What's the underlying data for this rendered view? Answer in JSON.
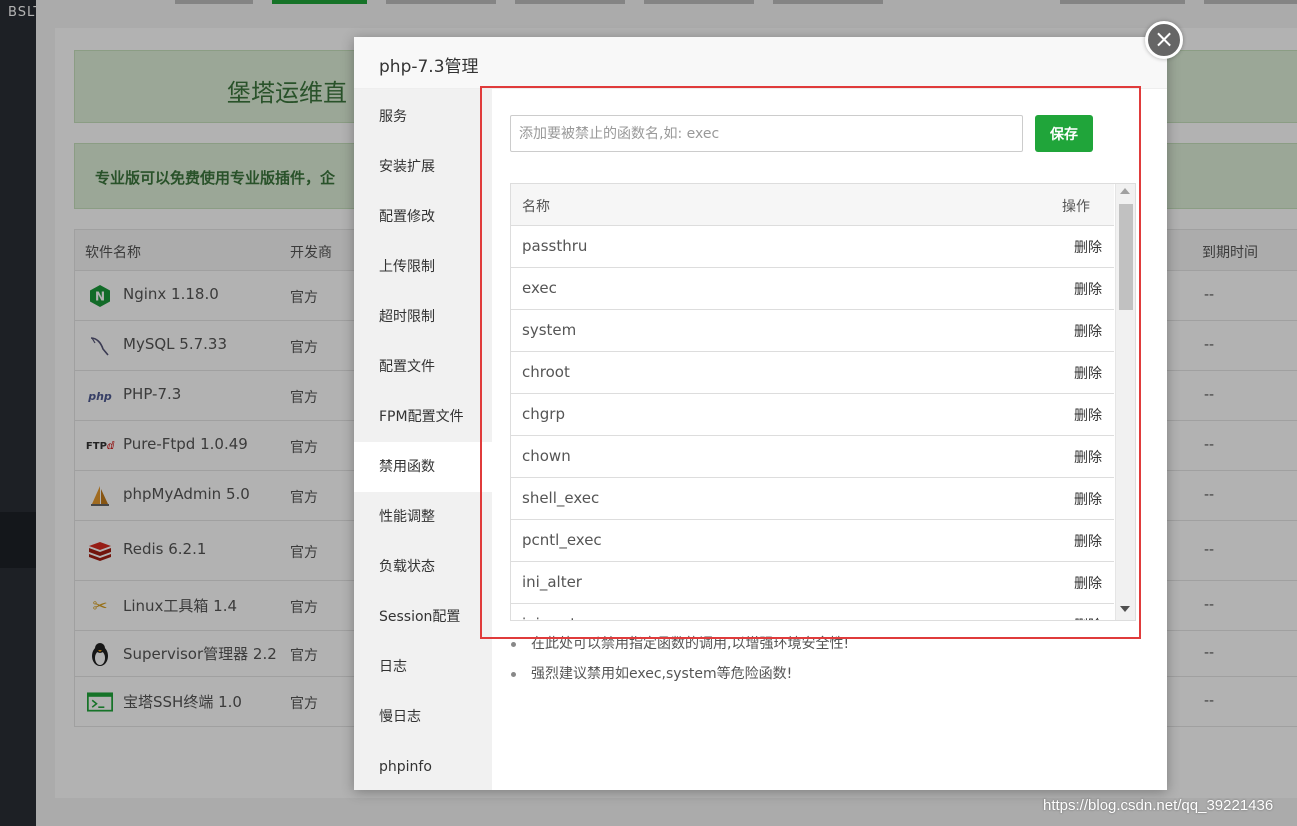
{
  "brand": "BSLT",
  "background": {
    "banner_title": "堡塔运维直",
    "banner_notice": "专业版可以免费使用专业版插件，企",
    "table_headers": {
      "name": "软件名称",
      "developer": "开发商",
      "expire": "到期时间"
    },
    "rows": [
      {
        "name": "Nginx 1.18.0",
        "developer": "官方",
        "expire": "--",
        "icon": "nginx-icon"
      },
      {
        "name": "MySQL 5.7.33",
        "developer": "官方",
        "expire": "--",
        "icon": "mysql-icon"
      },
      {
        "name": "PHP-7.3",
        "developer": "官方",
        "expire": "--",
        "icon": "php-icon"
      },
      {
        "name": "Pure-Ftpd 1.0.49",
        "developer": "官方",
        "expire": "--",
        "icon": "ftp-icon"
      },
      {
        "name": "phpMyAdmin 5.0",
        "developer": "官方",
        "expire": "--",
        "icon": "phpmyadmin-icon"
      },
      {
        "name": "Redis 6.2.1",
        "developer": "官方",
        "expire": "--",
        "icon": "redis-icon"
      },
      {
        "name": "Linux工具箱 1.4",
        "developer": "官方",
        "expire": "--",
        "icon": "toolbox-icon"
      },
      {
        "name": "Supervisor管理器 2.2",
        "developer": "官方",
        "expire": "--",
        "icon": "penguin-icon"
      },
      {
        "name": "宝塔SSH终端 1.0",
        "developer": "官方",
        "expire": "--",
        "icon": "terminal-icon"
      }
    ]
  },
  "modal": {
    "title": "php-7.3管理",
    "close_icon": "close-icon",
    "menu": [
      {
        "label": "服务"
      },
      {
        "label": "安装扩展"
      },
      {
        "label": "配置修改"
      },
      {
        "label": "上传限制"
      },
      {
        "label": "超时限制"
      },
      {
        "label": "配置文件"
      },
      {
        "label": "FPM配置文件"
      },
      {
        "label": "禁用函数"
      },
      {
        "label": "性能调整"
      },
      {
        "label": "负载状态"
      },
      {
        "label": "Session配置"
      },
      {
        "label": "日志"
      },
      {
        "label": "慢日志"
      },
      {
        "label": "phpinfo"
      }
    ],
    "active_menu": "禁用函数",
    "input_placeholder": "添加要被禁止的函数名,如: exec",
    "save_label": "保存",
    "list_headers": {
      "name": "名称",
      "action": "操作"
    },
    "functions": [
      {
        "name": "passthru",
        "action": "删除"
      },
      {
        "name": "exec",
        "action": "删除"
      },
      {
        "name": "system",
        "action": "删除"
      },
      {
        "name": "chroot",
        "action": "删除"
      },
      {
        "name": "chgrp",
        "action": "删除"
      },
      {
        "name": "chown",
        "action": "删除"
      },
      {
        "name": "shell_exec",
        "action": "删除"
      },
      {
        "name": "pcntl_exec",
        "action": "删除"
      },
      {
        "name": "ini_alter",
        "action": "删除"
      },
      {
        "name": "ini_restore",
        "action": "删除"
      }
    ],
    "tips": [
      "在此处可以禁用指定函数的调用,以增强环境安全性!",
      "强烈建议禁用如exec,system等危险函数!"
    ]
  },
  "watermark": "https://blog.csdn.net/qq_39221436",
  "colors": {
    "accent": "#20a53a",
    "highlight": "#e03b3b"
  }
}
